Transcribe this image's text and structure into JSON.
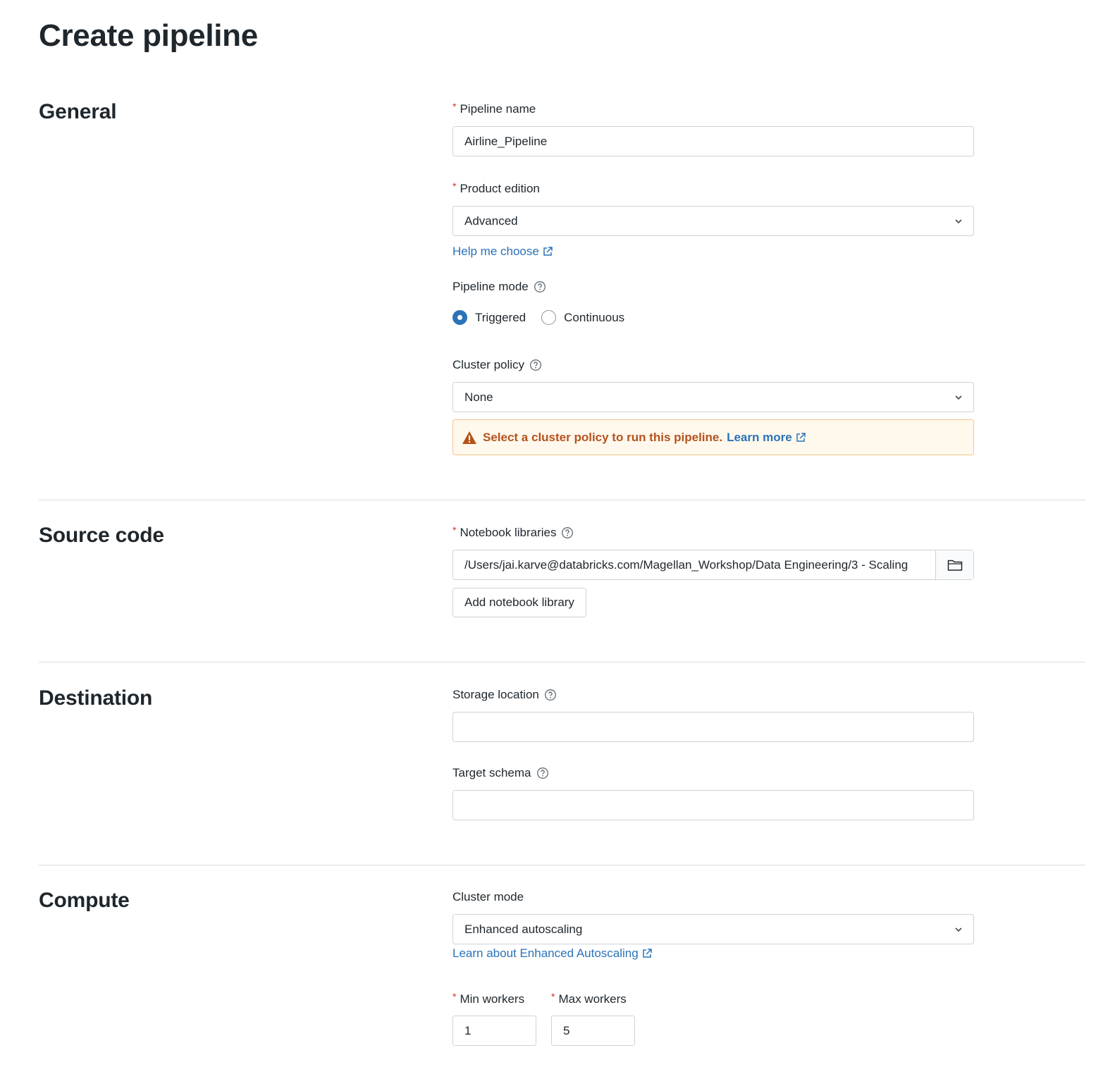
{
  "page": {
    "title": "Create pipeline"
  },
  "general": {
    "title": "General",
    "pipeline_name": {
      "label": "Pipeline name",
      "value": "Airline_Pipeline"
    },
    "product_edition": {
      "label": "Product edition",
      "value": "Advanced"
    },
    "help_link": "Help me choose",
    "pipeline_mode": {
      "label": "Pipeline mode",
      "options": [
        "Triggered",
        "Continuous"
      ],
      "selected": "Triggered"
    },
    "cluster_policy": {
      "label": "Cluster policy",
      "value": "None"
    },
    "warning": {
      "text": "Select a cluster policy to run this pipeline.",
      "link": "Learn more"
    }
  },
  "source_code": {
    "title": "Source code",
    "notebook_libraries": {
      "label": "Notebook libraries",
      "value": "/Users/jai.karve@databricks.com/Magellan_Workshop/Data Engineering/3 - Scaling"
    },
    "add_button": "Add notebook library"
  },
  "destination": {
    "title": "Destination",
    "storage_location": {
      "label": "Storage location",
      "value": ""
    },
    "target_schema": {
      "label": "Target schema",
      "value": ""
    }
  },
  "compute": {
    "title": "Compute",
    "cluster_mode": {
      "label": "Cluster mode",
      "value": "Enhanced autoscaling"
    },
    "learn_link": "Learn about Enhanced Autoscaling",
    "min_workers": {
      "label": "Min workers",
      "value": "1"
    },
    "max_workers": {
      "label": "Max workers",
      "value": "5"
    }
  },
  "colors": {
    "link": "#2b72b8",
    "required": "#d93025",
    "warning_text": "#b5531c",
    "warning_bg": "#fff8ed",
    "warning_border": "#f3c58a"
  }
}
